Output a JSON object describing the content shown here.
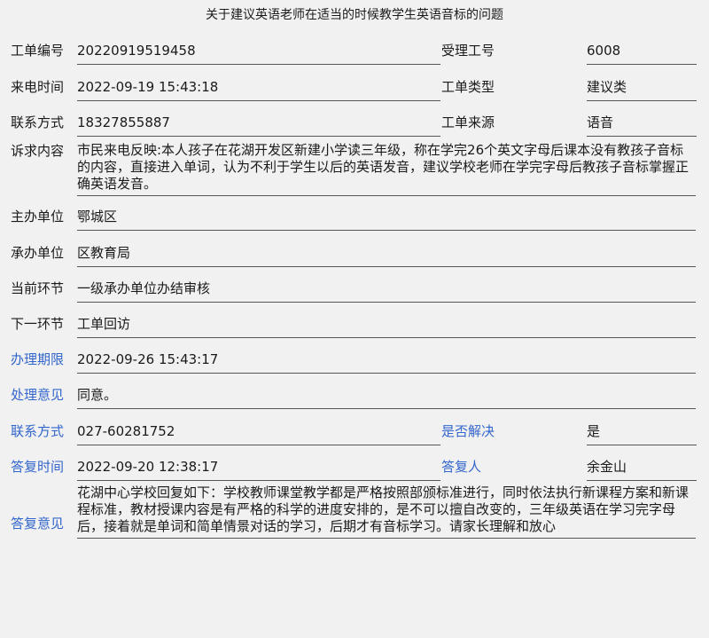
{
  "title": "关于建议英语老师在适当的时候教学生英语音标的问题",
  "fields": {
    "ticket_no_label": "工单编号",
    "ticket_no": "20220919519458",
    "receiver_label": "受理工号",
    "receiver": "6008",
    "call_time_label": "来电时间",
    "call_time": "2022-09-19 15:43:18",
    "ticket_type_label": "工单类型",
    "ticket_type": "建议类",
    "contact_label": "联系方式",
    "contact": "18327855887",
    "source_label": "工单来源",
    "source": "语音",
    "appeal_label": "诉求内容",
    "appeal": "市民来电反映:本人孩子在花湖开发区新建小学读三年级，称在学完26个英文字母后课本没有教孩子音标的内容，直接进入单词，认为不利于学生以后的英语发音，建议学校老师在学完字母后教孩子音标掌握正确英语发音。",
    "host_unit_label": "主办单位",
    "host_unit": "鄂城区",
    "handle_unit_label": "承办单位",
    "handle_unit": "区教育局",
    "current_step_label": "当前环节",
    "current_step": "一级承办单位办结审核",
    "next_step_label": "下一环节",
    "next_step": "工单回访",
    "deadline_label": "办理期限",
    "deadline": "2022-09-26 15:43:17",
    "opinion_label": "处理意见",
    "opinion": "同意。",
    "contact2_label": "联系方式",
    "contact2": "027-60281752",
    "resolved_label": "是否解决",
    "resolved": "是",
    "reply_time_label": "答复时间",
    "reply_time": "2022-09-20 12:38:17",
    "replier_label": "答复人",
    "replier": "余金山",
    "reply_label": "答复意见",
    "reply": "花湖中心学校回复如下：学校教师课堂教学都是严格按照部颁标准进行，同时依法执行新课程方案和新课程标准，教材授课内容是有严格的科学的进度安排的，是不可以擅自改变的，三年级英语在学习完字母后，接着就是单词和简单情景对话的学习，后期才有音标学习。请家长理解和放心"
  },
  "colors": {
    "label_blue": "#3366cc",
    "background": "#f1f1f1"
  }
}
